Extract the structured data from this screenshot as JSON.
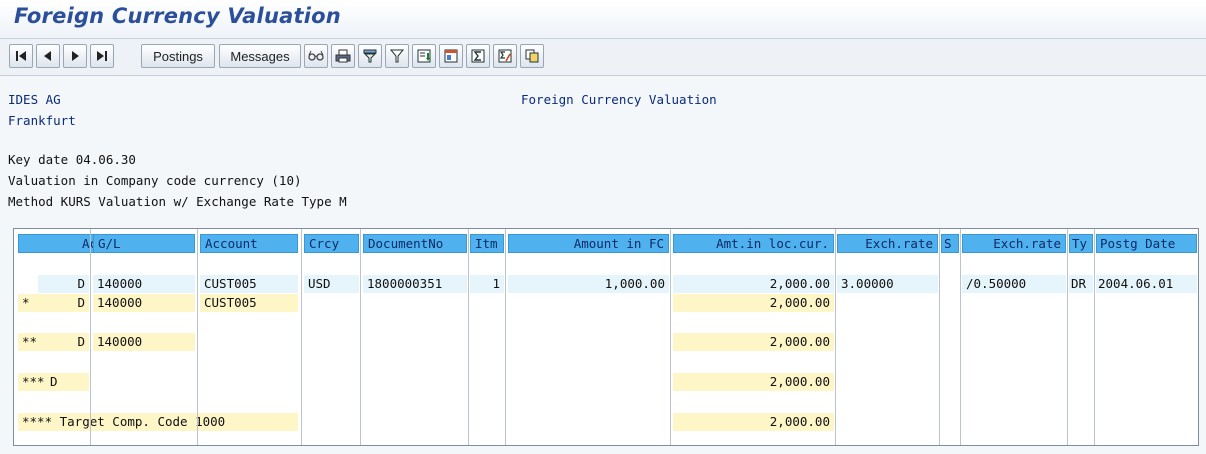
{
  "title": "Foreign Currency Valuation",
  "toolbar": {
    "buttons": [
      {
        "name": "first-page-button",
        "icon": "first-page-icon"
      },
      {
        "name": "previous-page-button",
        "icon": "previous-page-icon"
      },
      {
        "name": "next-page-button",
        "icon": "next-page-icon"
      },
      {
        "name": "last-page-button",
        "icon": "last-page-icon"
      }
    ],
    "postings_label": "Postings",
    "messages_label": "Messages",
    "icons": [
      "glasses-icon",
      "print-icon",
      "filter-icon",
      "filter-settings-icon",
      "sort-icon",
      "export-icon",
      "sum-icon",
      "subtotal-icon",
      "copy-icon"
    ]
  },
  "header": {
    "company": "IDES AG",
    "city": "Frankfurt",
    "report_title": "Foreign Currency Valuation",
    "key_date": "Key date 04.06.30",
    "valuation": "Valuation in Company code currency (10)",
    "method": "Method KURS Valuation w/ Exchange Rate Type M"
  },
  "table": {
    "columns": [
      "Ac",
      "G/L",
      "Account",
      "Crcy",
      "DocumentNo",
      "Itm",
      "Amount in FC",
      "Amt.in loc.cur.",
      "Exch.rate",
      "S",
      "Exch.rate",
      "Ty",
      "Postg Date"
    ],
    "rows": [
      {
        "prefix": "",
        "ac": "D",
        "gl": "140000",
        "account": "CUST005",
        "crcy": "USD",
        "docno": "1800000351",
        "itm": "1",
        "amt_fc": "1,000.00",
        "amt_loc": "2,000.00",
        "rate1": "3.00000",
        "s": "",
        "rate2": "/0.50000",
        "ty": "DR",
        "date": "2004.06.01"
      },
      {
        "prefix": "*",
        "ac": "D",
        "gl": "140000",
        "account": "CUST005",
        "crcy": "",
        "docno": "",
        "itm": "",
        "amt_fc": "",
        "amt_loc": "2,000.00",
        "rate1": "",
        "s": "",
        "rate2": "",
        "ty": "",
        "date": ""
      },
      {
        "prefix": "**",
        "ac": "D",
        "gl": "140000",
        "account": "",
        "amt_loc": "2,000.00"
      },
      {
        "prefix": "***",
        "ac": "D",
        "gl": "",
        "account": "",
        "amt_loc": "2,000.00"
      },
      {
        "total_label": "**** Target Comp. Code 1000",
        "amt_loc": "2,000.00"
      }
    ]
  }
}
